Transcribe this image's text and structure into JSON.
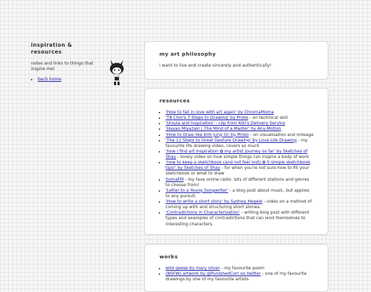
{
  "sidebar": {
    "title": "inspiration & resources",
    "description": "notes and links to things that inspire me!",
    "back_link": "back home"
  },
  "philosophy": {
    "title": "my art philosophy",
    "text": "i want to live and create sincerely and authentically!"
  },
  "resources": {
    "title": "resources",
    "items": [
      {
        "link": "'How to fall in love with art again' by ChromaMoma",
        "note": ""
      },
      {
        "link": "'T8 Choi's 7 Steps to Drawing' by Proko",
        "note": " - on technical skill"
      },
      {
        "link": "'Ursula and Inspiration' - clip from Kiki's Delivery Service",
        "note": ""
      },
      {
        "link": "'Hayao Miyazaki | The Mind of a Master' by Any-Motion",
        "note": ""
      },
      {
        "link": "'How to Draw like Kim Jung Gi' by Proko",
        "note": " - on visualisation and mileage"
      },
      {
        "link": "'The 11 Steps to Great Gesture Drawing' by Love Life Drawing",
        "note": " - my favourite life drawing video, covers so much"
      },
      {
        "link": "'how I find art inspiration ✿ my artist journey so far' by Sketches of Shay",
        "note": " - lovely video on how simple things can inspire a body of work"
      },
      {
        "link": "'how to keep a sketchbook (and not feel lost) ✿ 5 simple sketchbook tips!' by Sketches of Shay",
        "note": " - for when you're not sure how to fill your sketchbook or what to draw"
      },
      {
        "link": "SomaFM",
        "note": " - my fave online radio. lots of different stations and genres to choose from!"
      },
      {
        "link": "'Letter to a Young Songwriter'",
        "note": " - a blog post about music, but applies to any pursuit."
      },
      {
        "link": "'How to write a short story' by Sydney Hegele",
        "note": " - video on a method of coming up with and structuring short stories."
      },
      {
        "link": "'Contradictions in Characterization'",
        "note": " - writing blog post with different types and examples of contradictions that can lend themselves to interesting characters."
      }
    ]
  },
  "works": {
    "title": "works",
    "items": [
      {
        "link": "wild geese by mary oliver",
        "note": " - my favourite poem"
      },
      {
        "link": "(NSFW) artwork by @PunishedCorr on twitter",
        "note": " - one of my favourite drawings by one of my favourite artists"
      }
    ]
  }
}
